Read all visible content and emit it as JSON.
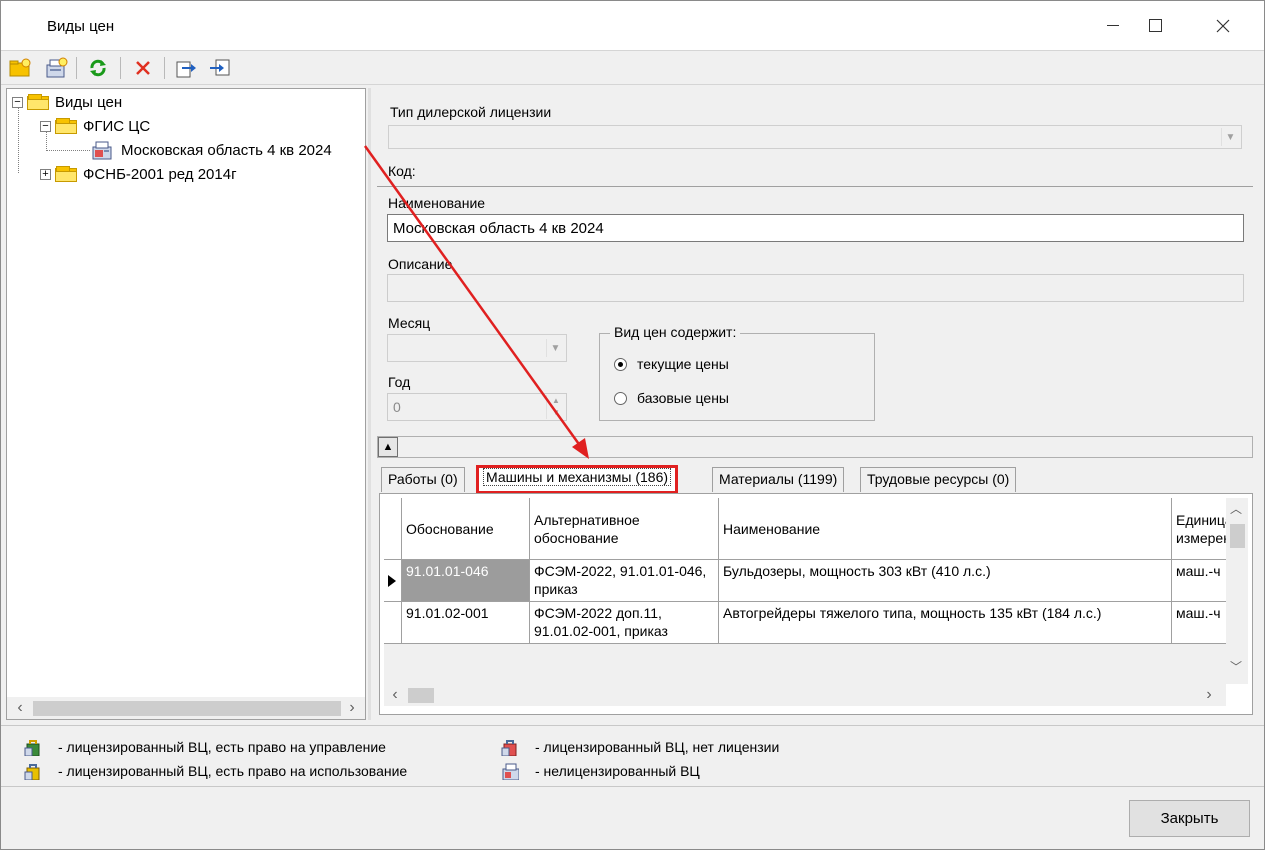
{
  "window": {
    "title": "Виды цен"
  },
  "toolbar": {
    "buttons": [
      "new-folder",
      "new-price-type",
      "refresh",
      "delete",
      "export",
      "import"
    ]
  },
  "tree": {
    "root": "Виды цен",
    "group1": "ФГИС ЦС",
    "item1": "Московская область 4 кв 2024",
    "group2": "ФСНБ-2001 ред 2014г"
  },
  "form": {
    "dealer_license_label": "Тип дилерской лицензии",
    "code_label": "Код:",
    "name_label": "Наименование",
    "name_value": "Московская область 4 кв 2024",
    "description_label": "Описание",
    "month_label": "Месяц",
    "year_label": "Год",
    "year_value": "0",
    "contains_label": "Вид цен содержит:",
    "current_prices": "текущие цены",
    "base_prices": "базовые цены",
    "selected_price_kind": "текущие цены"
  },
  "tabs": {
    "works": "Работы (0)",
    "machines": "Машины и механизмы (186)",
    "materials": "Материалы (1199)",
    "labor": "Трудовые ресурсы (0)",
    "active": "Машины и механизмы (186)"
  },
  "grid": {
    "headers": {
      "basis": "Обоснование",
      "alt_basis": "Альтернативное обоснование",
      "name": "Наименование",
      "unit": "Единица измерения"
    },
    "rows": [
      {
        "basis": "91.01.01-046",
        "alt_basis": "ФСЭМ-2022, 91.01.01-046, приказ",
        "name": "Бульдозеры, мощность 303 кВт (410 л.с.)",
        "unit": "маш.-ч"
      },
      {
        "basis": "91.01.02-001",
        "alt_basis": "ФСЭМ-2022 доп.11, 91.01.02-001, приказ",
        "name": "Автогрейдеры тяжелого типа, мощность 135 кВт (184 л.с.)",
        "unit": "маш.-ч"
      }
    ]
  },
  "legend": {
    "licensed_manage": "- лицензированный ВЦ, есть право на управление",
    "licensed_use": "- лицензированный ВЦ, есть право на использование",
    "licensed_no_license": "- лицензированный ВЦ, нет лицензии",
    "unlicensed": "- нелицензированный ВЦ"
  },
  "buttons": {
    "close": "Закрыть"
  },
  "colors": {
    "highlight": "#e02020",
    "folder": "#f7c200",
    "selected_cell": "#9c9c9c"
  }
}
